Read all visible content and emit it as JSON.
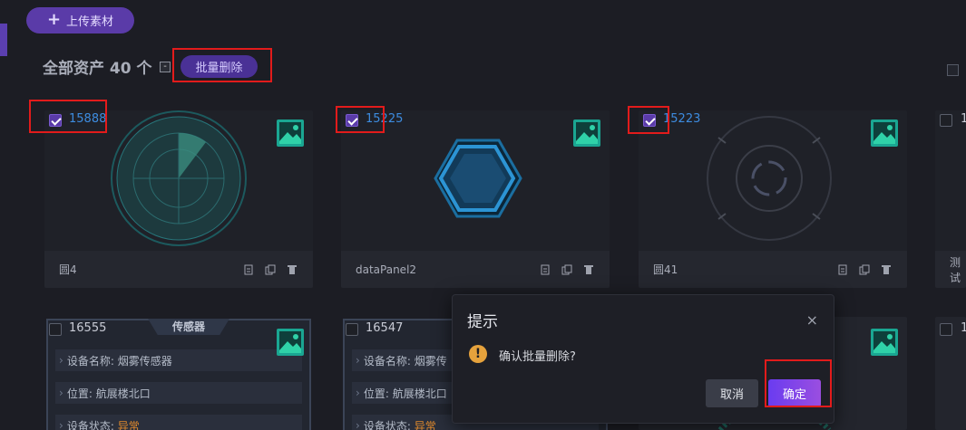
{
  "toolbar": {
    "upload_label": "上传素材"
  },
  "header": {
    "title": "全部资产 40 个",
    "batch_delete_label": "批量删除",
    "collapse_symbol": "-"
  },
  "cards": [
    {
      "id": "15888",
      "name": "圆4",
      "checked": true
    },
    {
      "id": "15225",
      "name": "dataPanel2",
      "checked": true
    },
    {
      "id": "15223",
      "name": "圆41",
      "checked": true
    },
    {
      "id": "1",
      "name": "测试",
      "checked": false
    }
  ],
  "row2": [
    {
      "id": "16555",
      "panel_title": "传感器",
      "rows": [
        {
          "label": "设备名称:",
          "value": "烟雾传感器"
        },
        {
          "label": "位置:",
          "value": "航展楼北口"
        },
        {
          "label": "设备状态:",
          "value": "异常"
        }
      ]
    },
    {
      "id": "16547",
      "panel_title": "",
      "rows": [
        {
          "label": "设备名称:",
          "value": "烟雾传"
        },
        {
          "label": "位置:",
          "value": "航展楼北口"
        },
        {
          "label": "设备状态:",
          "value": "异常"
        }
      ]
    },
    {
      "id": "1"
    }
  ],
  "dialog": {
    "title": "提示",
    "message": "确认批量删除?",
    "cancel_label": "取消",
    "confirm_label": "确定",
    "close_symbol": "×",
    "warn_symbol": "!"
  },
  "colors": {
    "accent": "#5a3ba8",
    "link": "#3d8ce0",
    "warning": "#e6a23c",
    "highlight": "#e21b1b"
  }
}
